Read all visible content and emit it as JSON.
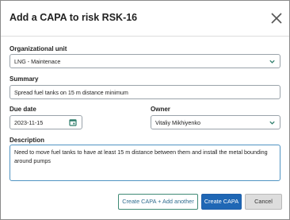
{
  "dialog": {
    "title": "Add a CAPA to risk RSK-16",
    "close_icon": "close-icon"
  },
  "form": {
    "org_unit": {
      "label": "Organizational unit",
      "value": "LNG - Maintenace",
      "icon": "chevron-down-icon"
    },
    "summary": {
      "label": "Summary",
      "value": "Spread fuel tanks on 15 m distance minimum"
    },
    "due_date": {
      "label": "Due date",
      "value": "2023-11-15",
      "icon": "calendar-icon"
    },
    "owner": {
      "label": "Owner",
      "value": "Vitaliy Mikhiyenko",
      "icon": "chevron-down-icon"
    },
    "description": {
      "label": "Description",
      "value": "Need to move fuel tanks to have at least 15 m distance between them and install the metal bounding around pumps"
    }
  },
  "buttons": {
    "create_add_another": "Create CAPA + Add another",
    "create": "Create CAPA",
    "cancel": "Cancel"
  },
  "colors": {
    "accent": "#1f67b5",
    "chevron": "#2e7d6b",
    "focus_border": "#4f93c2"
  }
}
